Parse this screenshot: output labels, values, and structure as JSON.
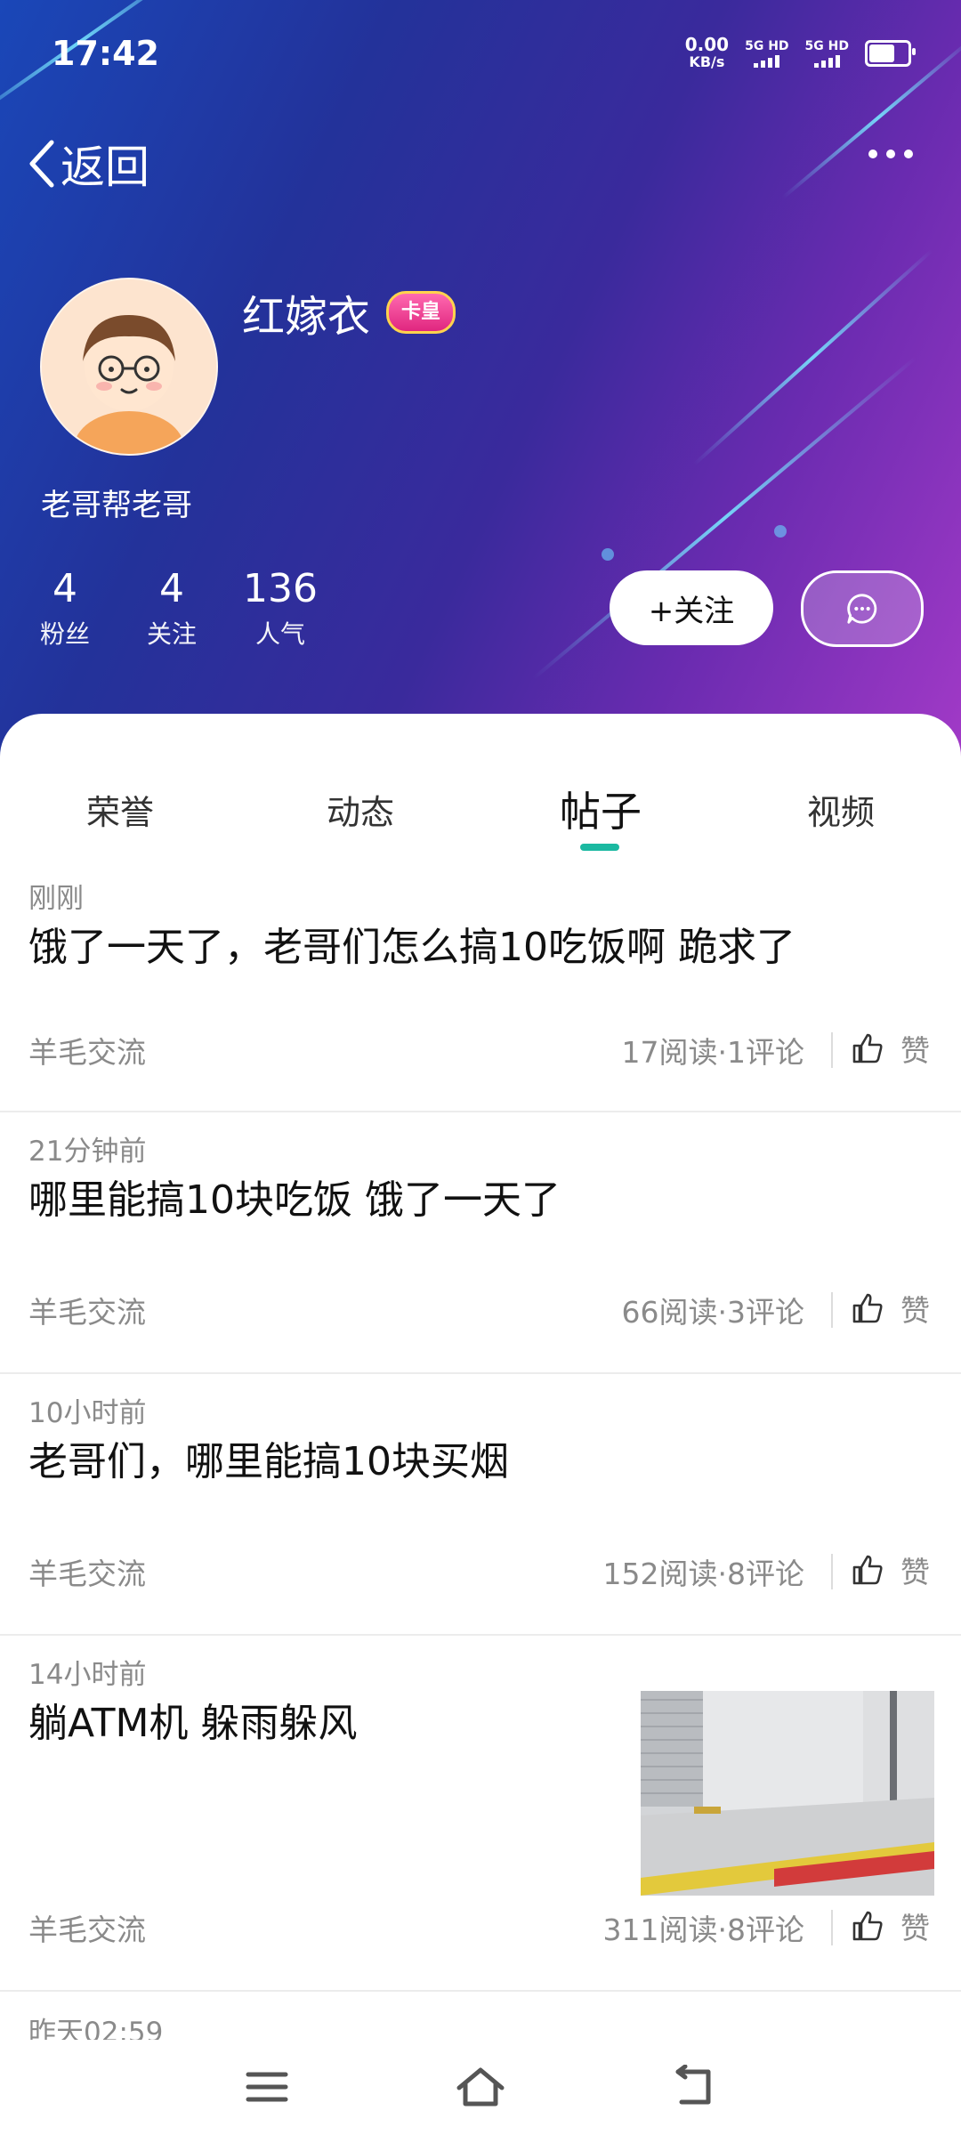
{
  "status_bar": {
    "time": "17:42",
    "net_speed": "0.00",
    "net_unit": "KB/s",
    "sim1": "5G HD",
    "sim2": "5G HD",
    "battery_level": 0.6
  },
  "nav": {
    "back_label": "返回"
  },
  "profile": {
    "name": "红嫁衣",
    "badge": "卡皇",
    "bio": "老哥帮老哥",
    "stats": [
      {
        "value": "4",
        "label": "粉丝"
      },
      {
        "value": "4",
        "label": "关注"
      },
      {
        "value": "136",
        "label": "人气"
      }
    ],
    "follow_label": "+关注"
  },
  "tabs": [
    {
      "label": "荣誉",
      "active": false
    },
    {
      "label": "动态",
      "active": false
    },
    {
      "label": "帖子",
      "active": true
    },
    {
      "label": "视频",
      "active": false
    }
  ],
  "posts": [
    {
      "time": "刚刚",
      "title": "饿了一天了，老哥们怎么搞10吃饭啊 跪求了",
      "category": "羊毛交流",
      "meta": "17阅读·1评论",
      "like_label": "赞"
    },
    {
      "time": "21分钟前",
      "title": "哪里能搞10块吃饭 饿了一天了",
      "category": "羊毛交流",
      "meta": "66阅读·3评论",
      "like_label": "赞"
    },
    {
      "time": "10小时前",
      "title": "老哥们，哪里能搞10块买烟",
      "category": "羊毛交流",
      "meta": "152阅读·8评论",
      "like_label": "赞"
    },
    {
      "time": "14小时前",
      "title": "躺ATM机 躲雨躲风",
      "category": "羊毛交流",
      "meta": "311阅读·8评论",
      "like_label": "赞"
    },
    {
      "time": "昨天02:59"
    }
  ],
  "colors": {
    "accent": "#1bb9a1",
    "hero_start": "#1a47b8",
    "hero_end": "#a23ac7"
  }
}
